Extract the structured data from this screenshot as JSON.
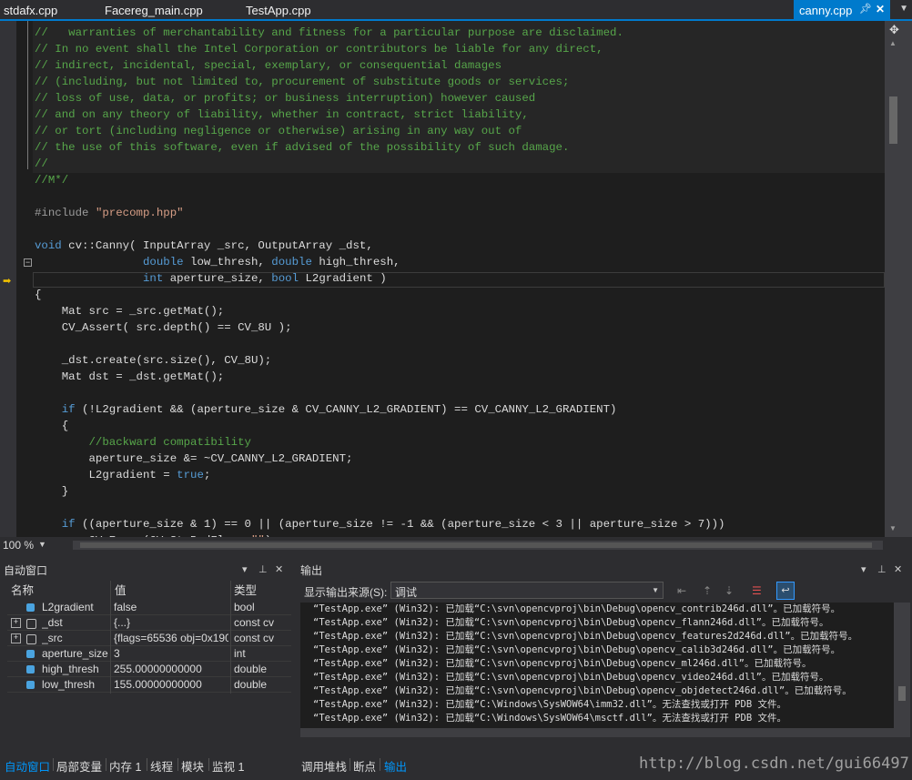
{
  "tabs": {
    "items": [
      "stdafx.cpp",
      "Facereg_main.cpp",
      "TestApp.cpp"
    ],
    "active": "canny.cpp"
  },
  "editor": {
    "zoom": "100 %"
  },
  "auto_window": {
    "title": "自动窗口",
    "columns": [
      "名称",
      "值",
      "类型"
    ],
    "rows": [
      {
        "name": "L2gradient",
        "value": "false",
        "type": "bool"
      },
      {
        "name": "_dst",
        "value": "{...}",
        "type": "const cv"
      },
      {
        "name": "_src",
        "value": "{flags=65536 obj=0x190",
        "type": "const cv"
      },
      {
        "name": "aperture_size",
        "value": "3",
        "type": "int"
      },
      {
        "name": "high_thresh",
        "value": "255.00000000000",
        "type": "double"
      },
      {
        "name": "low_thresh",
        "value": "155.00000000000",
        "type": "double"
      }
    ]
  },
  "output": {
    "title": "输出",
    "source_label": "显示输出来源(S):",
    "source_value": "调试",
    "lines": [
      "“TestApp.exe” (Win32): 已加载“C:\\svn\\opencvproj\\bin\\Debug\\opencv_contrib246d.dll”。已加载符号。",
      "“TestApp.exe” (Win32): 已加载“C:\\svn\\opencvproj\\bin\\Debug\\opencv_flann246d.dll”。已加载符号。",
      "“TestApp.exe” (Win32): 已加载“C:\\svn\\opencvproj\\bin\\Debug\\opencv_features2d246d.dll”。已加载符号。",
      "“TestApp.exe” (Win32): 已加载“C:\\svn\\opencvproj\\bin\\Debug\\opencv_calib3d246d.dll”。已加载符号。",
      "“TestApp.exe” (Win32): 已加载“C:\\svn\\opencvproj\\bin\\Debug\\opencv_ml246d.dll”。已加载符号。",
      "“TestApp.exe” (Win32): 已加载“C:\\svn\\opencvproj\\bin\\Debug\\opencv_video246d.dll”。已加载符号。",
      "“TestApp.exe” (Win32): 已加载“C:\\svn\\opencvproj\\bin\\Debug\\opencv_objdetect246d.dll”。已加载符号。",
      "“TestApp.exe” (Win32): 已加载“C:\\Windows\\SysWOW64\\imm32.dll”。无法查找或打开 PDB 文件。",
      "“TestApp.exe” (Win32): 已加载“C:\\Windows\\SysWOW64\\msctf.dll”。无法查找或打开 PDB 文件。"
    ]
  },
  "bottom_tabs_left": [
    "自动窗口",
    "局部变量",
    "内存 1",
    "线程",
    "模块",
    "监视 1"
  ],
  "bottom_tabs_right": [
    "调用堆栈",
    "断点",
    "输出"
  ],
  "watermark": "http://blog.csdn.net/gui66497"
}
